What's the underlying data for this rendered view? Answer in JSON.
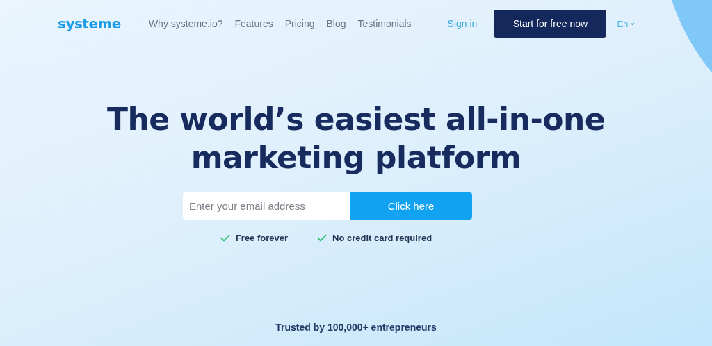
{
  "header": {
    "logo": "systeme",
    "nav": [
      "Why systeme.io?",
      "Features",
      "Pricing",
      "Blog",
      "Testimonials"
    ],
    "sign_in": "Sign in",
    "cta": "Start for free now",
    "language": "En"
  },
  "hero": {
    "headline_lines": [
      "The world’s easiest all-in-one",
      "marketing platform"
    ],
    "email": {
      "placeholder": "Enter your email address"
    },
    "submit": "Click here",
    "benefits": [
      "Free forever",
      "No credit card required"
    ],
    "trusted": "Trusted by 100,000+ entrepreneurs"
  }
}
